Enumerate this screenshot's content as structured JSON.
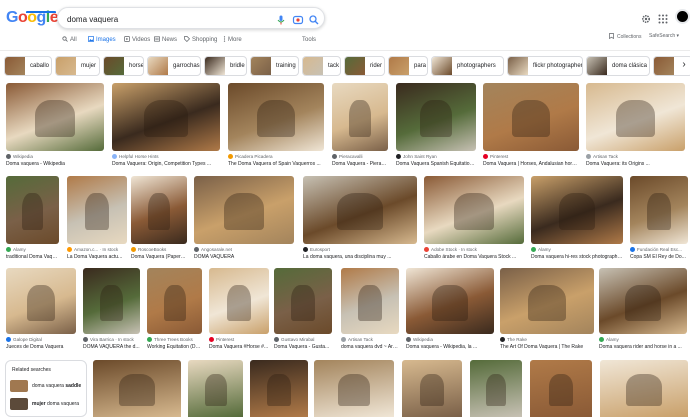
{
  "logo_letters": [
    {
      "t": "G",
      "c": "#4285F4"
    },
    {
      "t": "o",
      "c": "#EA4335"
    },
    {
      "t": "o",
      "c": "#FBBC05"
    },
    {
      "t": "g",
      "c": "#4285F4"
    },
    {
      "t": "l",
      "c": "#34A853"
    },
    {
      "t": "e",
      "c": "#EA4335"
    }
  ],
  "search": {
    "value": "doma vaquera"
  },
  "tabs": [
    {
      "label": "All",
      "icon": "search-icon"
    },
    {
      "label": "Images",
      "icon": "image-icon",
      "active": true
    },
    {
      "label": "Videos",
      "icon": "video-icon"
    },
    {
      "label": "News",
      "icon": "news-icon"
    },
    {
      "label": "Shopping",
      "icon": "tag-icon"
    },
    {
      "label": "More",
      "icon": "more-vert-icon"
    }
  ],
  "tools_label": "Tools",
  "collections_label": "Collections",
  "safesearch_label": "SafeSearch ▾",
  "chips": [
    "caballo",
    "mujer",
    "horse",
    "garrochas",
    "bridle",
    "training",
    "tack",
    "rider",
    "para",
    "photographers",
    "flickr photographers",
    "doma clásica",
    "sad"
  ],
  "results": [
    {
      "src": "Wikipedia",
      "title": "Doma vaquera - Wikipedia",
      "fav": "#5f6368"
    },
    {
      "src": "Helpful Horse Hints",
      "title": "Doma Vaquera: Origin, Competition Types ...",
      "fav": "#8ab4f8"
    },
    {
      "src": "Picadera Picadera",
      "title": "The Doma Vaquera of Spain Vaquerros ...",
      "fav": "#f29900"
    },
    {
      "src": "Pieracavalli",
      "title": "Doma Vaquera - Pieracavalli - Pieraci...",
      "fav": "#5f6368"
    },
    {
      "src": "John Saint Ryan",
      "title": "Doma Vaquera Spanish Equitation ...",
      "fav": "#202124"
    },
    {
      "src": "Pinterest",
      "title": "Doma Vaquera | Horses, Andalusian horse ...",
      "fav": "#e60023"
    },
    {
      "src": "Artisan Tack",
      "title": "Doma Vaquera: its Origins ...",
      "fav": "#9aa0a6"
    },
    {
      "src": "Alamy",
      "title": "traditional Doma Vaquer...",
      "fav": "#34a853"
    },
    {
      "src": "Amazon.c... · In stock",
      "title": "La Doma Vaquera actu...",
      "fav": "#ff9900"
    },
    {
      "src": "RoscoeBooks",
      "title": "Doma Vaquera (Paperb...",
      "fav": "#f29900"
    },
    {
      "src": "Angosarale.net",
      "title": "DOMA VAQUERA",
      "fav": "#5f6368"
    },
    {
      "src": "Eurosport",
      "title": "La doma vaquera, una disciplina muy ...",
      "fav": "#202124"
    },
    {
      "src": "Adobe Stock · In stock",
      "title": "Caballo árabe en Doma Vaquera Stock ...",
      "fav": "#ea4335"
    },
    {
      "src": "Alamy",
      "title": "Doma vaquera hi-res stock photography ...",
      "fav": "#34a853"
    },
    {
      "src": "Fundación Real Esc...",
      "title": "Copa SM El Rey de Do...",
      "fav": "#1a73e8"
    },
    {
      "src": "Galope Digital",
      "title": "Jueces de Doma Vaquera",
      "fav": "#1a73e8"
    },
    {
      "src": "Vira Barrica · In stock",
      "title": "DOMA VAQUERA the d...",
      "fav": "#5f6368"
    },
    {
      "src": "Three Trees Books",
      "title": "Working Equitation (Do...",
      "fav": "#34a853"
    },
    {
      "src": "Pinterest",
      "title": "Doma Vaquera #Horse #...",
      "fav": "#e60023"
    },
    {
      "src": "Gustavo Mirabal",
      "title": "Doma Vaquera - Gusta...",
      "fav": "#5f6368"
    },
    {
      "src": "Artisan Tack",
      "title": "doma vaquera dvd ~ Artis...",
      "fav": "#9aa0a6"
    },
    {
      "src": "Wikipedia",
      "title": "Doma vaquera - Wikipedia, la ...",
      "fav": "#5f6368"
    },
    {
      "src": "The Rake",
      "title": "The Art Of Doma Vaquera | The Rake",
      "fav": "#202124"
    },
    {
      "src": "Alamy",
      "title": "Doma vaquera rider and horse in a ...",
      "fav": "#34a853"
    }
  ],
  "related": {
    "title": "Related searches",
    "items": [
      {
        "prefix": "doma vaquera ",
        "bold": "saddle"
      },
      {
        "prefix": "",
        "bold": "mujer",
        "suffix": " doma vaquera"
      }
    ]
  },
  "colors": {
    "brand_blue": "#1a73e8",
    "tile_palette": [
      "#8a5a36",
      "#c9a06a",
      "#6b4a2a",
      "#e8d9c0",
      "#3a2a1e",
      "#a3845c",
      "#d7b98f",
      "#556b3a",
      "#b07a48",
      "#f0e6d6",
      "#7a6048",
      "#c7c1b4"
    ]
  }
}
